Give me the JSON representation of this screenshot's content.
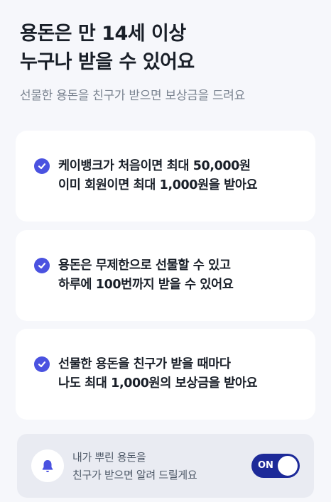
{
  "header": {
    "title_line1": "용돈은 만 14세 이상",
    "title_line2": "누구나 받을 수 있어요",
    "subtitle": "선물한 용돈을 친구가 받으면 보상금을 드려요"
  },
  "benefits": [
    {
      "line1": "케이뱅크가 처음이면 최대 50,000원",
      "line2": "이미 회원이면 최대 1,000원을 받아요"
    },
    {
      "line1": "용돈은 무제한으로 선물할 수 있고",
      "line2": "하루에 100번까지 받을 수 있어요"
    },
    {
      "line1": "선물한 용돈을 친구가 받을 때마다",
      "line2": "나도 최대 1,000원의 보상금을 받아요"
    }
  ],
  "notification": {
    "line1": "내가 뿌린 용돈을",
    "line2": "친구가 받으면 알려 드릴게요",
    "toggle_label": "ON",
    "toggle_on": true
  },
  "colors": {
    "accent": "#4a52e0",
    "toggle_bg": "#1d2a99",
    "page_bg": "#f6f7fb"
  },
  "icons": {
    "check": "check-circle-icon",
    "bell": "bell-icon"
  }
}
